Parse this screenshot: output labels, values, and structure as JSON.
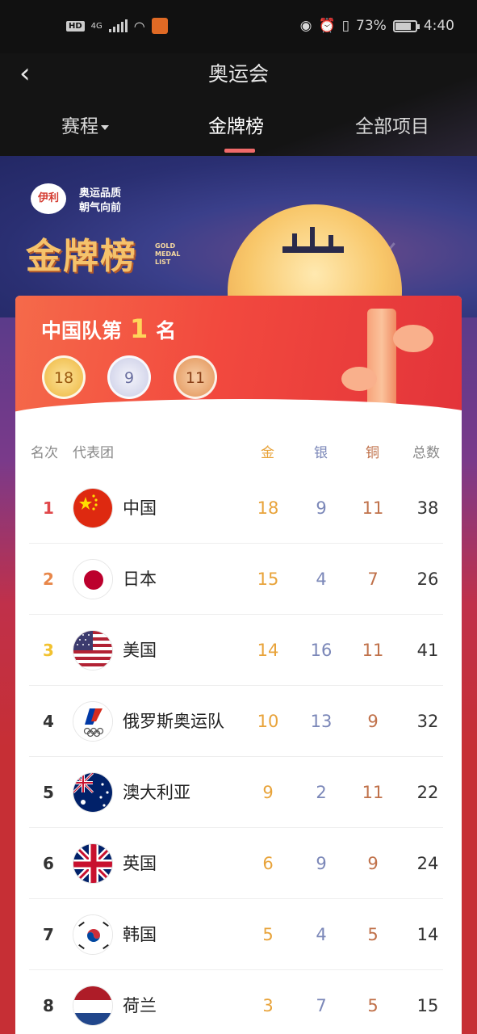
{
  "status_bar": {
    "hd": "HD",
    "network": "4G",
    "battery_percent": "73%",
    "time": "4:40"
  },
  "header": {
    "title": "奥运会",
    "tabs": [
      {
        "label": "赛程"
      },
      {
        "label": "金牌榜"
      },
      {
        "label": "全部项目"
      }
    ],
    "active_tab": 1
  },
  "banner": {
    "sponsor_logo_text": "伊利",
    "slogan_line1": "奥运品质",
    "slogan_line2": "朝气向前",
    "title": "金牌榜",
    "subtitle_lines": [
      "GOLD",
      "MEDAL",
      "LIST"
    ]
  },
  "summary": {
    "prefix": "中国队第",
    "rank": "1",
    "suffix": "名",
    "gold": "18",
    "silver": "9",
    "bronze": "11"
  },
  "table": {
    "headers": {
      "rank": "名次",
      "team": "代表团",
      "gold": "金",
      "silver": "银",
      "bronze": "铜",
      "total": "总数"
    },
    "rows": [
      {
        "rank": "1",
        "name": "中国",
        "gold": "18",
        "silver": "9",
        "bronze": "11",
        "total": "38",
        "flag": "china-flag-icon",
        "rank_color": "#e0474a"
      },
      {
        "rank": "2",
        "name": "日本",
        "gold": "15",
        "silver": "4",
        "bronze": "7",
        "total": "26",
        "flag": "japan-flag-icon",
        "rank_color": "#e8874a"
      },
      {
        "rank": "3",
        "name": "美国",
        "gold": "14",
        "silver": "16",
        "bronze": "11",
        "total": "41",
        "flag": "usa-flag-icon",
        "rank_color": "#f2c230"
      },
      {
        "rank": "4",
        "name": "俄罗斯奥运队",
        "gold": "10",
        "silver": "13",
        "bronze": "9",
        "total": "32",
        "flag": "roc-flag-icon",
        "rank_color": "#333333"
      },
      {
        "rank": "5",
        "name": "澳大利亚",
        "gold": "9",
        "silver": "2",
        "bronze": "11",
        "total": "22",
        "flag": "australia-flag-icon",
        "rank_color": "#333333"
      },
      {
        "rank": "6",
        "name": "英国",
        "gold": "6",
        "silver": "9",
        "bronze": "9",
        "total": "24",
        "flag": "uk-flag-icon",
        "rank_color": "#333333"
      },
      {
        "rank": "7",
        "name": "韩国",
        "gold": "5",
        "silver": "4",
        "bronze": "5",
        "total": "14",
        "flag": "korea-flag-icon",
        "rank_color": "#333333"
      },
      {
        "rank": "8",
        "name": "荷兰",
        "gold": "3",
        "silver": "7",
        "bronze": "5",
        "total": "15",
        "flag": "netherlands-flag-icon",
        "rank_color": "#333333"
      }
    ]
  },
  "colors": {
    "gold": "#e8a33a",
    "silver": "#7b87b8",
    "bronze": "#c0714a",
    "accent": "#f06a6a"
  }
}
